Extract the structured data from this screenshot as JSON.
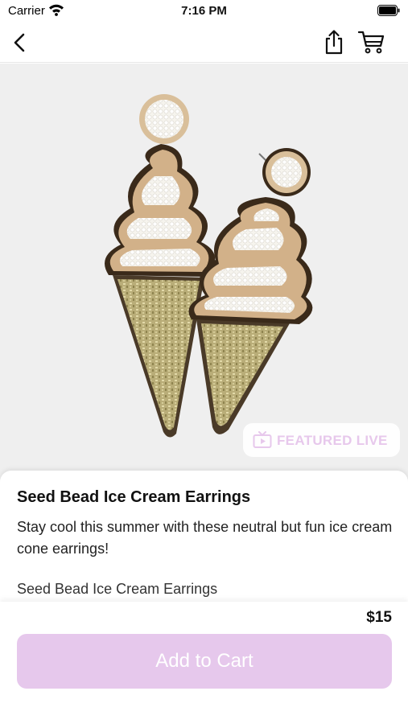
{
  "status_bar": {
    "carrier": "Carrier",
    "time": "7:16 PM"
  },
  "nav": {
    "back_icon": "chevron-left-icon",
    "share_icon": "share-icon",
    "cart_icon": "cart-icon"
  },
  "product": {
    "image_subject": "beaded ice cream cone earrings",
    "badge": {
      "icon": "tv-play-icon",
      "label": "FEATURED LIVE"
    },
    "title": "Seed Bead Ice Cream Earrings",
    "description": "Stay cool this summer with these neutral but fun ice cream cone earrings!",
    "description_extra": "Seed Bead Ice Cream Earrings",
    "price": "$15"
  },
  "actions": {
    "add_to_cart": "Add to Cart"
  },
  "colors": {
    "accent": "#e6c8ec",
    "image_bg": "#efefef"
  }
}
